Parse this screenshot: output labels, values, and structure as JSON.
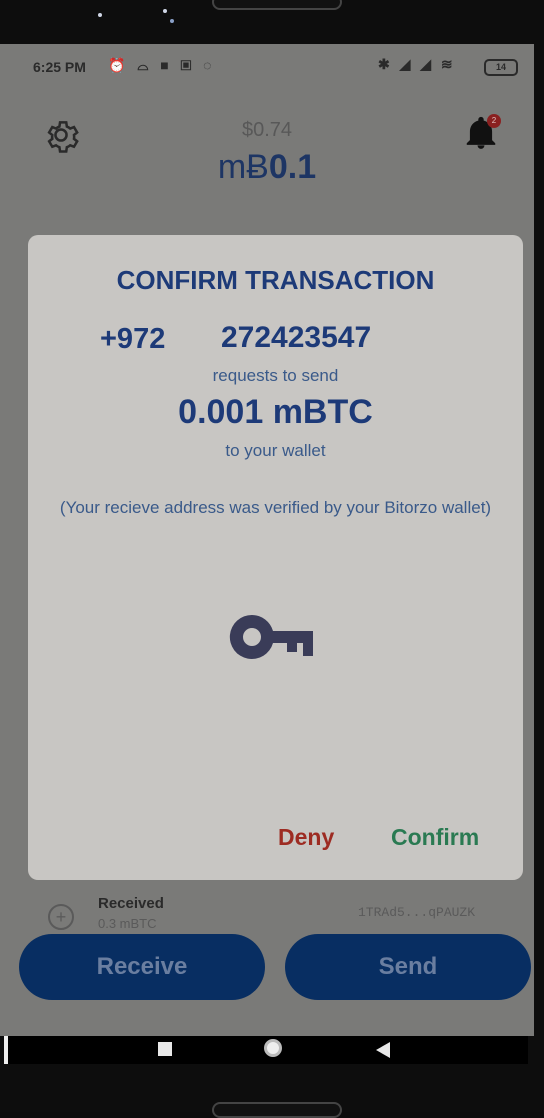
{
  "status_bar": {
    "time": "6:25 PM",
    "left_icons": "⏰ ⌓ ■ ▣ ◌",
    "right_icons": "✱ ◢ ◢ ≋",
    "battery": "14"
  },
  "header": {
    "balance_usd": "$0.74",
    "balance_unit": "mɃ",
    "balance_value": "0.1",
    "notification_count": "2"
  },
  "modal": {
    "title": "CONFIRM TRANSACTION",
    "phone_country_code": "+972",
    "phone_number": "272423547",
    "requests_text": "requests to send",
    "amount": "0.001 mBTC",
    "to_wallet_text": "to your wallet",
    "verified_text": "(Your recieve address was verified by your Bitorzo wallet)",
    "deny_label": "Deny",
    "confirm_label": "Confirm"
  },
  "transaction": {
    "title": "Received",
    "amount": "0.3 mBTC",
    "address": "1TRAd5...qPAUZK"
  },
  "actions": {
    "receive_label": "Receive",
    "send_label": "Send"
  },
  "colors": {
    "primary": "#082e62",
    "title_blue": "#1d3a78",
    "deny_red": "#9d2b22",
    "confirm_green": "#2a7a52"
  }
}
